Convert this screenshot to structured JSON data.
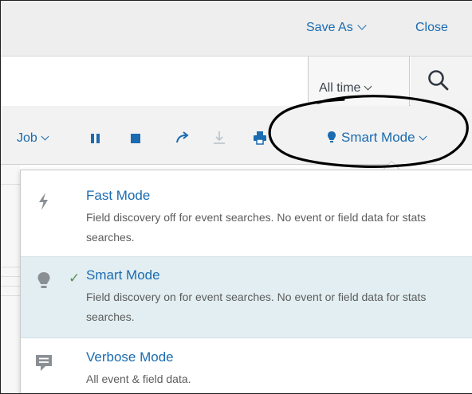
{
  "header": {
    "save_as": "Save As",
    "close": "Close"
  },
  "search": {
    "query": "",
    "time_range": "All time"
  },
  "toolbar": {
    "job_menu": "Job",
    "icons": [
      "pause-icon",
      "stop-icon",
      "share-icon",
      "export-icon",
      "print-icon"
    ],
    "mode_button": "Smart Mode"
  },
  "mode_menu": {
    "selected": "Smart Mode",
    "items": [
      {
        "title": "Fast Mode",
        "description": "Field discovery off for event searches. No event or field data for stats searches.",
        "icon": "lightning-icon",
        "checked": false
      },
      {
        "title": "Smart Mode",
        "description": "Field discovery on for event searches. No event or field data for stats searches.",
        "icon": "lightbulb-icon",
        "checked": true
      },
      {
        "title": "Verbose Mode",
        "description": "All event & field data.",
        "icon": "comment-icon",
        "checked": false
      }
    ],
    "check_mark": "✓"
  },
  "colors": {
    "link": "#1a6bb0",
    "selected_row": "#e2eef1",
    "check": "#5a8e58",
    "annotation": "#000000"
  }
}
